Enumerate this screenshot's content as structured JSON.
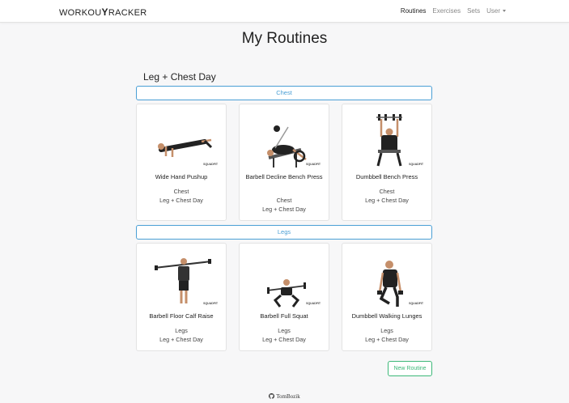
{
  "nav": {
    "brand_left": "WORKOU",
    "brand_y": "Y",
    "brand_right": "RACKER",
    "links": [
      "Routines",
      "Exercises",
      "Sets"
    ],
    "user": "User"
  },
  "page_title": "My Routines",
  "routine_name": "Leg + Chest Day",
  "groups": [
    {
      "label": "Chest",
      "cards": [
        {
          "name": "Wide Hand Pushup",
          "muscle": "Chest",
          "routine": "Leg + Chest Day",
          "watermark": "SQUADFIT"
        },
        {
          "name": "Barbell Decline Bench Press",
          "muscle": "Chest",
          "routine": "Leg + Chest Day",
          "watermark": "SQUADFIT"
        },
        {
          "name": "Dumbbell Bench Press",
          "muscle": "Chest",
          "routine": "Leg + Chest Day",
          "watermark": "SQUADFIT"
        }
      ]
    },
    {
      "label": "Legs",
      "cards": [
        {
          "name": "Barbell Floor Calf Raise",
          "muscle": "Legs",
          "routine": "Leg + Chest Day",
          "watermark": "SQUADFIT"
        },
        {
          "name": "Barbell Full Squat",
          "muscle": "Legs",
          "routine": "Leg + Chest Day",
          "watermark": "SQUADFIT"
        },
        {
          "name": "Dumbbell Walking Lunges",
          "muscle": "Legs",
          "routine": "Leg + Chest Day",
          "watermark": "SQUADFIT"
        }
      ]
    }
  ],
  "new_routine_label": "New Routine",
  "footer": {
    "author": "TomBozik",
    "icon": "github-icon"
  },
  "colors": {
    "accent_blue": "#4a9fd5",
    "accent_green": "#3cb878"
  }
}
